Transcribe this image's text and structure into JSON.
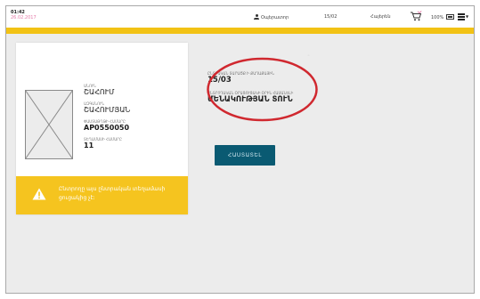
{
  "status": {
    "time": "01:42",
    "date": "26.02.2017",
    "user": "Օպերատոր",
    "center": "15/02",
    "language": "Հայերեն",
    "battery": "100%"
  },
  "card": {
    "header": "",
    "fields": [
      {
        "label": "ԱՆՈՒՆ",
        "value": "ՇԱՀՈՒՄ"
      },
      {
        "label": "ԱԶԳԱՆՈՒՆ",
        "value": "ՇԱՀՈՒՄՅԱՆ"
      },
      {
        "label": "ՓԱՍՏԱԹՂԹԻ ՀԱՄԱՐԸ",
        "value": "AP0550050"
      },
      {
        "label": "ՏԵՂԱՄԱՍԻ ՀԱՄԱՐԸ",
        "value": "11"
      }
    ],
    "warning": "Ընտրողը այս ընտրական տեղամասի ցուցակից չէ:"
  },
  "info": {
    "precinct_label": "ԸՆՏՐԱԿԱՆ ՏԱՐԱԾՔ Ի ՔԱՂԱՔԱՅԻՆ",
    "precinct_value": "15/03",
    "reason_label": "ԸՆՏՐՈՂԱԿԱՆ ՕՐԱՑՈՒՑԱԿԻ ՕՐԻՆ ՀԱՍԱՆԵԼԻ",
    "reason_value": "ՄԵՆԱԿՈՒԹՅԱՆ ՏՈՒՆ",
    "dot": "◦"
  },
  "actions": {
    "confirm_label": "ՀԱՍՏԱՏԵԼ"
  },
  "colors": {
    "accent_yellow": "#f2c214",
    "warning_yellow": "#f5c41f",
    "confirm_button": "#0a5a72",
    "annotation_red": "#d0282f"
  },
  "icons": {
    "user": "user-icon",
    "cart": "cart-icon",
    "battery": "battery-icon",
    "menu": "hamburger-menu-icon",
    "warning": "warning-triangle-icon",
    "photo": "photo-placeholder-icon"
  }
}
